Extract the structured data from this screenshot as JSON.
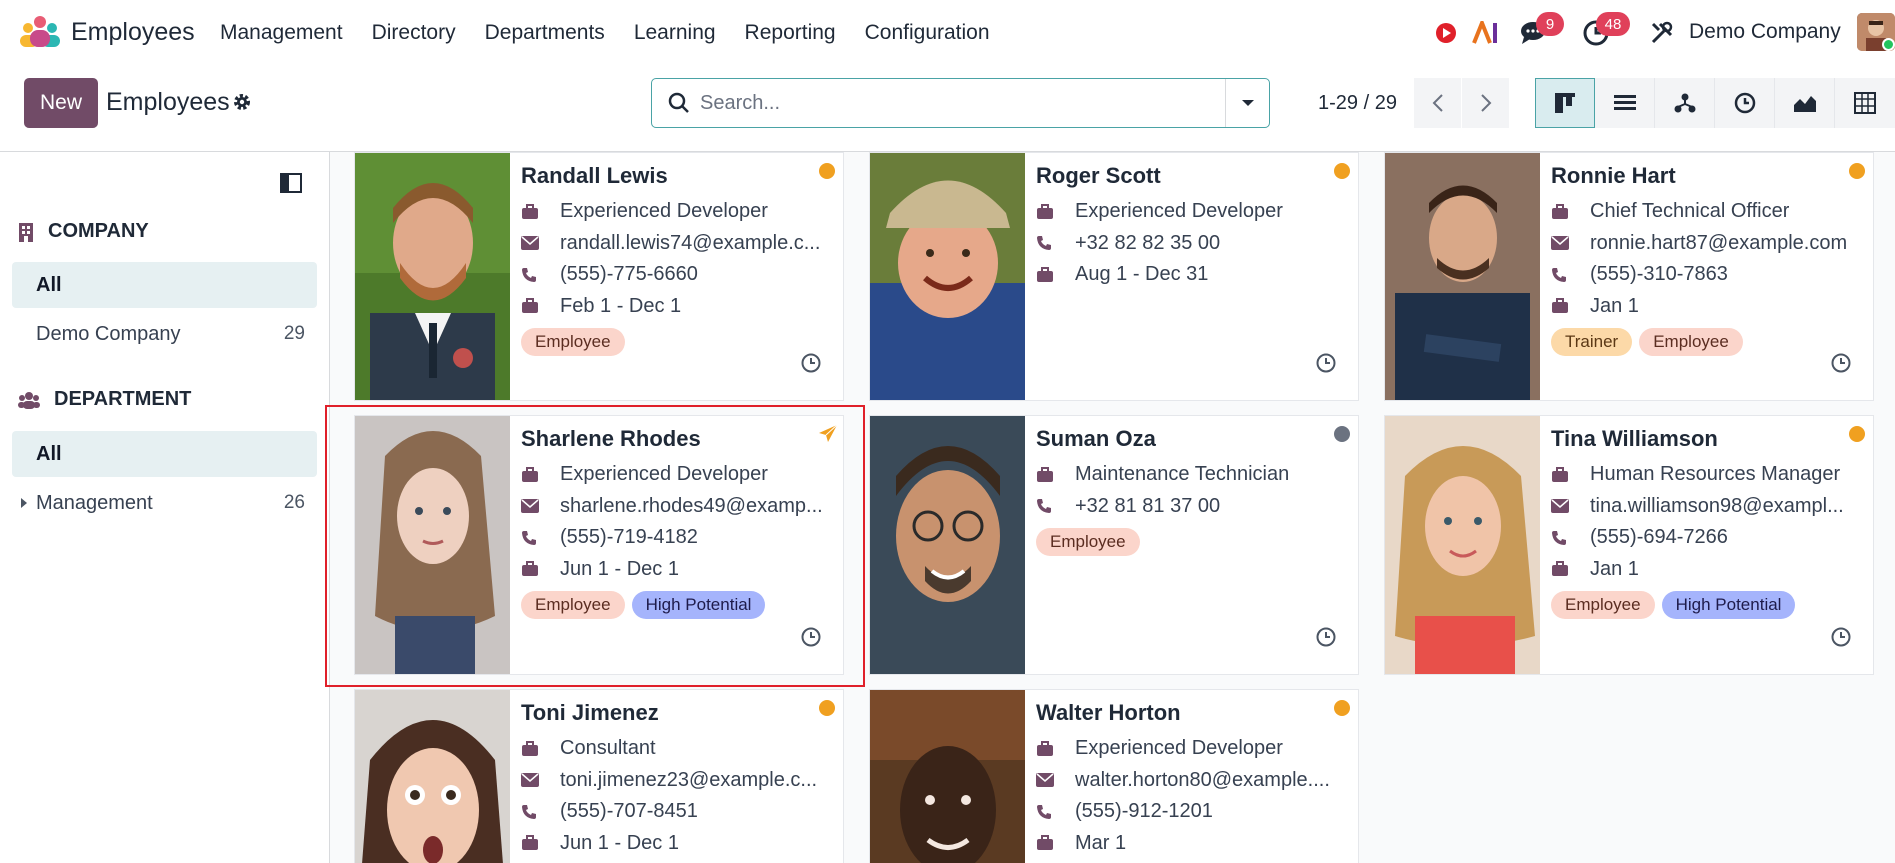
{
  "navbar": {
    "app_name": "Employees",
    "menu": [
      "Management",
      "Directory",
      "Departments",
      "Learning",
      "Reporting",
      "Configuration"
    ],
    "messages_badge": "9",
    "activities_badge": "48",
    "company": "Demo Company",
    "icons": [
      "record-icon",
      "ai-icon",
      "chat-icon",
      "clock-icon",
      "tools-icon"
    ]
  },
  "control": {
    "new_label": "New",
    "title": "Employees",
    "search_placeholder": "Search...",
    "pager": "1-29 / 29",
    "views": [
      "kanban-view",
      "list-view",
      "hierarchy-view",
      "activity-view",
      "graph-view",
      "pivot-view"
    ]
  },
  "sidebar": {
    "company_heading": "COMPANY",
    "company_items": [
      {
        "label": "All",
        "count": ""
      },
      {
        "label": "Demo Company",
        "count": "29"
      }
    ],
    "department_heading": "DEPARTMENT",
    "department_items": [
      {
        "label": "All",
        "count": ""
      },
      {
        "label": "Management",
        "count": "26"
      }
    ]
  },
  "cards": [
    {
      "name": "Randall Lewis",
      "job": "Experienced Developer",
      "email": "randall.lewis74@example.c...",
      "phone": "(555)-775-6660",
      "period": "Feb 1 - Dec 1",
      "tags": [
        "Employee"
      ],
      "status": "orange"
    },
    {
      "name": "Roger Scott",
      "job": "Experienced Developer",
      "phone": "+32 82 82 35 00",
      "period": "Aug 1 - Dec 31",
      "tags": [],
      "status": "orange"
    },
    {
      "name": "Ronnie Hart",
      "job": "Chief Technical Officer",
      "email": "ronnie.hart87@example.com",
      "phone": "(555)-310-7863",
      "period": "Jan 1",
      "tags": [
        "Trainer",
        "Employee"
      ],
      "status": "orange"
    },
    {
      "name": "Sharlene Rhodes",
      "job": "Experienced Developer",
      "email": "sharlene.rhodes49@examp...",
      "phone": "(555)-719-4182",
      "period": "Jun 1 - Dec 1",
      "tags": [
        "Employee",
        "High Potential"
      ],
      "status": "plane"
    },
    {
      "name": "Suman Oza",
      "job": "Maintenance Technician",
      "phone": "+32 81 81 37 00",
      "tags": [
        "Employee"
      ],
      "status": "gray"
    },
    {
      "name": "Tina Williamson",
      "job": "Human Resources Manager",
      "email": "tina.williamson98@exampl...",
      "phone": "(555)-694-7266",
      "period": "Jan 1",
      "tags": [
        "Employee",
        "High Potential"
      ],
      "status": "orange"
    },
    {
      "name": "Toni Jimenez",
      "job": "Consultant",
      "email": "toni.jimenez23@example.c...",
      "phone": "(555)-707-8451",
      "period": "Jun 1 - Dec 1",
      "tags": [],
      "status": "orange"
    },
    {
      "name": "Walter Horton",
      "job": "Experienced Developer",
      "email": "walter.horton80@example....",
      "phone": "(555)-912-1201",
      "period": "Mar 1",
      "tags": [],
      "status": "orange"
    }
  ],
  "colors": {
    "brand": "#714b67",
    "accent": "#4aa3a6",
    "badge": "#e0405a"
  }
}
